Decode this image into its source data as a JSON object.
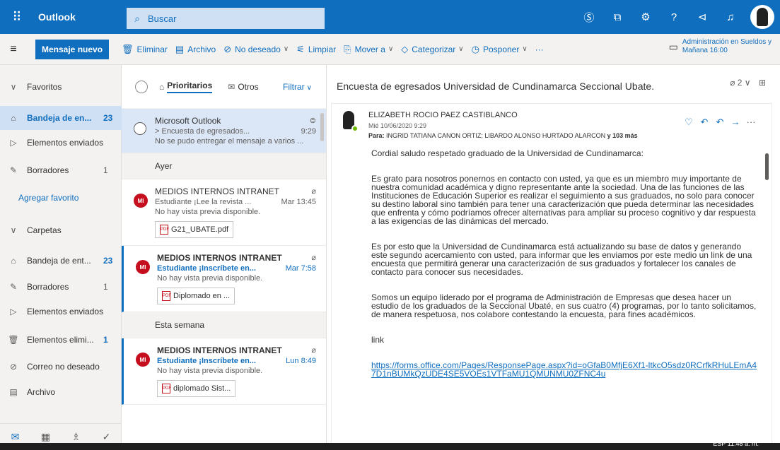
{
  "topbar": {
    "app_name": "Outlook",
    "search_placeholder": "Buscar"
  },
  "commandbar": {
    "new_message": "Mensaje nuevo",
    "commands": [
      {
        "label": "Eliminar",
        "icon": "trash-icon",
        "chevron": false
      },
      {
        "label": "Archivo",
        "icon": "archive-icon",
        "chevron": false
      },
      {
        "label": "No deseado",
        "icon": "block-icon",
        "chevron": true
      },
      {
        "label": "Limpiar",
        "icon": "broom-icon",
        "chevron": false
      },
      {
        "label": "Mover a",
        "icon": "move-icon",
        "chevron": true
      },
      {
        "label": "Categorizar",
        "icon": "tag-icon",
        "chevron": true
      },
      {
        "label": "Posponer",
        "icon": "clock-icon",
        "chevron": true
      }
    ],
    "more": "···",
    "reminder_title": "Administración en Sueldos y",
    "reminder_time": "Mañana 16:00"
  },
  "leftnav": {
    "favorites_header": "Favoritos",
    "favorites": [
      {
        "label": "Bandeja de en...",
        "count": "23"
      },
      {
        "label": "Elementos enviados",
        "count": ""
      },
      {
        "label": "Borradores",
        "count": "1"
      }
    ],
    "add_favorite": "Agregar favorito",
    "folders_header": "Carpetas",
    "folders": [
      {
        "label": "Bandeja de ent...",
        "count": "23"
      },
      {
        "label": "Borradores",
        "count": "1"
      },
      {
        "label": "Elementos enviados",
        "count": ""
      },
      {
        "label": "Elementos elimi...",
        "count": "1"
      },
      {
        "label": "Correo no deseado",
        "count": ""
      },
      {
        "label": "Archivo",
        "count": ""
      }
    ]
  },
  "maillist": {
    "tab_focused": "Prioritarios",
    "tab_other": "Otros",
    "filter": "Filtrar",
    "group_yesterday": "Ayer",
    "group_week": "Esta semana",
    "messages": [
      {
        "from": "Microsoft Outlook",
        "subject": "> Encuesta de egresados...",
        "time": "9:29",
        "preview": "No se pudo entregar el mensaje a varios ..."
      },
      {
        "avatar": "MI",
        "from": "MEDIOS INTERNOS INTRANET",
        "subject": "Estudiante ¡Lee la revista ...",
        "time": "Mar 13:45",
        "preview": "No hay vista previa disponible.",
        "attachment": "G21_UBATE.pdf"
      },
      {
        "avatar": "MI",
        "from": "MEDIOS INTERNOS INTRANET",
        "subject": "Estudiante ¡Inscríbete en...",
        "time": "Mar 7:58",
        "preview": "No hay vista previa disponible.",
        "attachment": "Diplomado en ..."
      },
      {
        "avatar": "MI",
        "from": "MEDIOS INTERNOS INTRANET",
        "subject": "Estudiante ¡Inscríbete en...",
        "time": "Lun 8:49",
        "preview": "No hay vista previa disponible.",
        "attachment": "diplomado Sist..."
      }
    ]
  },
  "reading": {
    "subject": "Encuesta de egresados Universidad de Cundinamarca Seccional Ubate.",
    "attachment_count": "2",
    "sender": "ELIZABETH ROCIO PAEZ CASTIBLANCO",
    "date": "Mié 10/06/2020 9:29",
    "to_label": "Para:",
    "to": "INGRID TATIANA CANON ORTIZ; LIBARDO ALONSO HURTADO ALARCON",
    "to_more": "y 103 más",
    "paragraphs": [
      "Cordial saludo respetado graduado de la Universidad de Cundinamarca:",
      "Es grato para nosotros ponernos en contacto con usted, ya que es un miembro muy importante de nuestra comunidad académica y digno representante ante la sociedad.  Una de las funciones de las Instituciones de Educación Superior es realizar el seguimiento a sus graduados, no solo para conocer su destino laboral sino también para tener una caracterización que pueda determinar las necesidades que enfrenta y cómo podríamos ofrecer alternativas para ampliar su proceso cognitivo y dar respuesta a las exigencias de las dinámicas del mercado.",
      "Es por esto que la Universidad de Cundinamarca está actualizando su base de datos y generando este segundo acercamiento con usted, para informar que les enviamos por este medio un link de una encuesta que permitirá generar una caracterización de sus graduados y fortalecer los canales de contacto para conocer sus necesidades.",
      "Somos un equipo liderado por el programa de Administración de Empresas que desea hacer un estudio de los graduados de la Seccional Ubaté, en sus cuatro (4) programas, por lo tanto solicitamos, de manera respetuosa, nos colabore contestando  la encuesta, para fines académicos.",
      "link"
    ],
    "link": "https://forms.office.com/Pages/ResponsePage.aspx?id=oGfaB0MfjE6Xf1-ltkcO5sdz0RCrfkRHuLEmA47D1nBUMkQzUDE4SE5VOEs1VTFaMU1QMUNMU0ZFNC4u"
  },
  "taskbar": {
    "tray": "ESP   11:48 a. m."
  },
  "colors": {
    "brand": "#106ebe",
    "selection": "#cfe0f5",
    "avatar_red": "#c50f1f"
  }
}
